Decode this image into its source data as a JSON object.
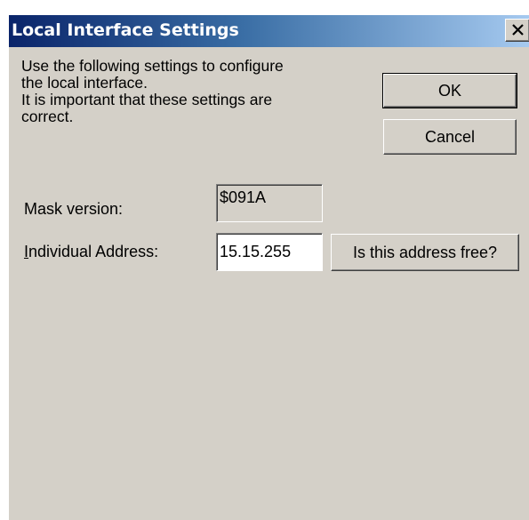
{
  "window": {
    "title": "Local Interface Settings",
    "close_icon": "close-x-icon"
  },
  "intro": {
    "lines": [
      "Use the following settings to configure",
      "the local interface.",
      "It is important that these settings are",
      "correct."
    ]
  },
  "buttons": {
    "ok": "OK",
    "cancel": "Cancel",
    "check_free": "Is this address free?"
  },
  "mask": {
    "label": "Mask version:",
    "value": "$091A"
  },
  "address": {
    "label_accel": "I",
    "label_rest": "ndividual Address:",
    "value": "15.15.255"
  },
  "colors": {
    "dialog_face": "#d4d0c8",
    "title_active_start": "#0a246a",
    "title_active_end": "#a6caf0"
  }
}
